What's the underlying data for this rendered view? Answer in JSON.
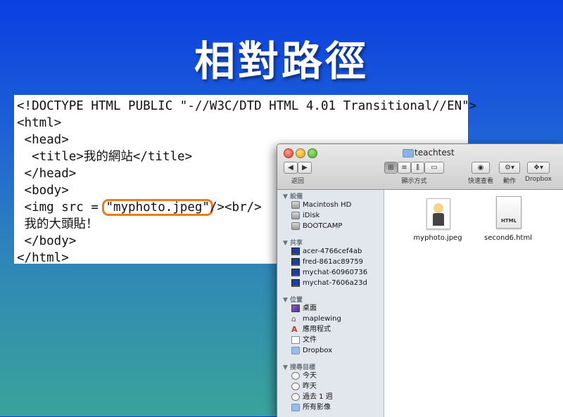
{
  "slide": {
    "title": "相對路徑"
  },
  "code": {
    "lines": [
      "<!DOCTYPE HTML PUBLIC \"-//W3C/DTD HTML 4.01 Transitional//EN\">",
      "<html>",
      " <head>",
      "  <title>我的網站</title>",
      " </head>",
      " <body>",
      " 我的大頭貼！",
      " </body>",
      "</html>"
    ],
    "img_line_before": " <img src = ",
    "img_line_highlight": "\"myphoto.jpeg\"",
    "img_line_after": "/><br/>"
  },
  "finder": {
    "title": "teachtest",
    "toolbar": {
      "back_label": "返回",
      "view_label": "顯示方式",
      "quicklook_label": "快速查看",
      "action_label": "動作",
      "dropbox_label": "Dropbox"
    },
    "sidebar": {
      "devices_header": "▼ 設備",
      "devices": [
        "Macintosh HD",
        "iDisk",
        "BOOTCAMP"
      ],
      "shared_header": "▼ 共享",
      "shared": [
        "acer-4766cef4ab",
        "fred-861ac89759",
        "mychat-60960736",
        "mychat-7606a23d"
      ],
      "places_header": "▼ 位置",
      "places": [
        "桌面",
        "maplewing",
        "應用程式",
        "文件",
        "Dropbox"
      ],
      "search_header": "▼ 搜尋目標",
      "search": [
        "今天",
        "昨天",
        "過去 1 週",
        "所有影像"
      ]
    },
    "files": [
      {
        "name": "myphoto.jpeg",
        "icon": "image-thumbnail-icon"
      },
      {
        "name": "second6.html",
        "icon": "html-document-icon",
        "badge": "HTML"
      }
    ]
  },
  "colors": {
    "highlight": "#ee7a1e"
  }
}
